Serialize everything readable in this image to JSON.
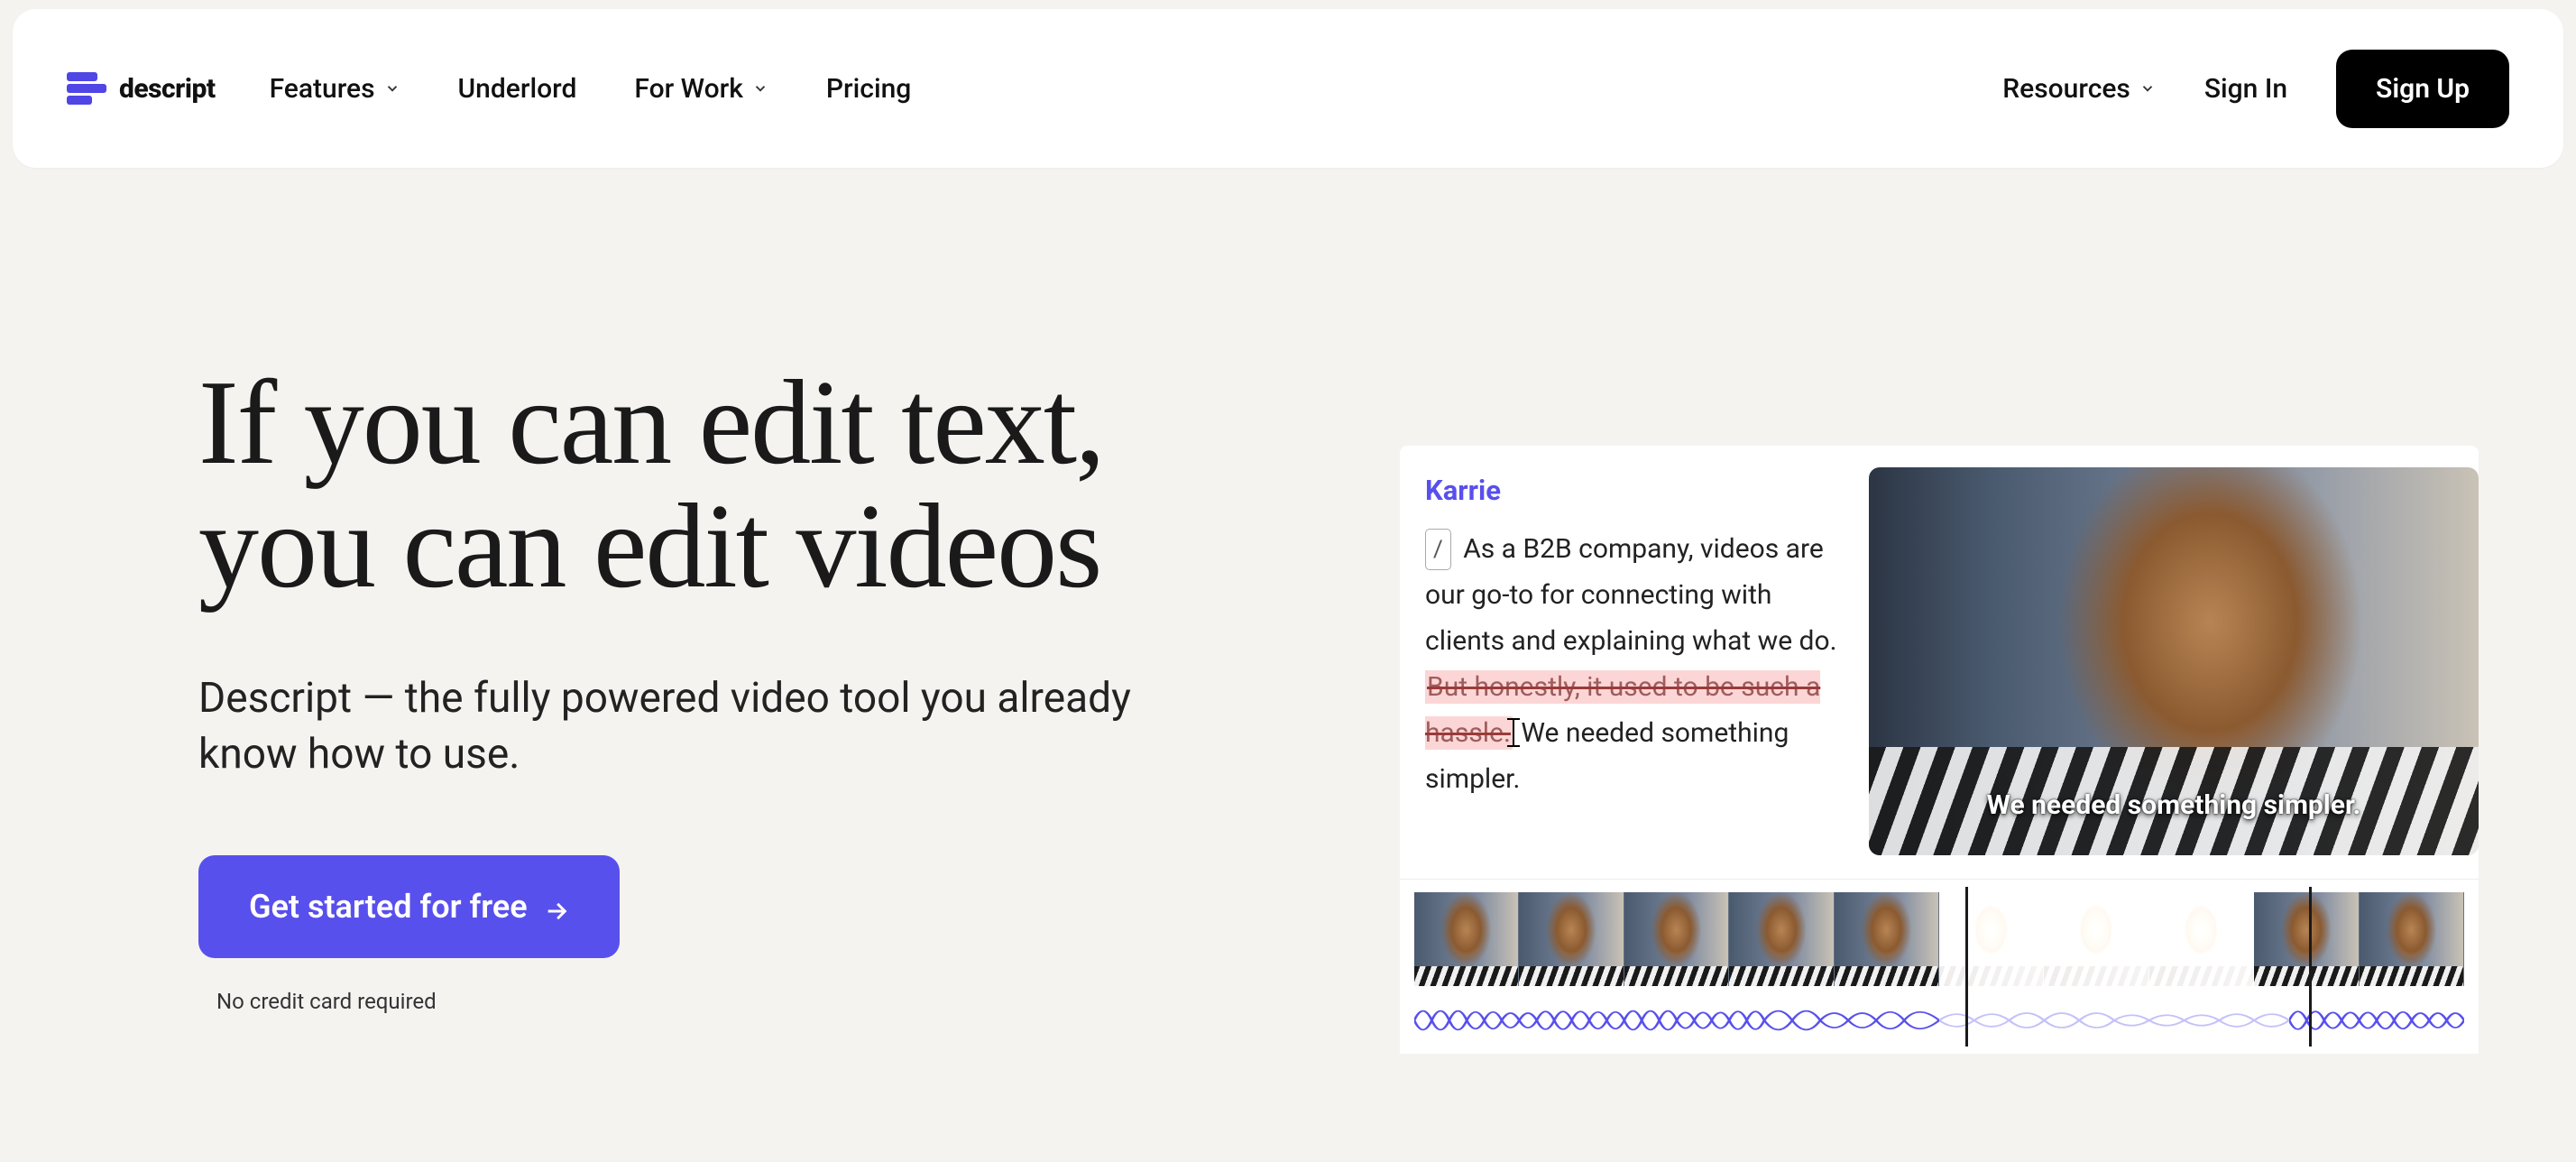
{
  "brand": {
    "name": "descript"
  },
  "nav": {
    "items": [
      {
        "label": "Features",
        "hasDropdown": true
      },
      {
        "label": "Underlord",
        "hasDropdown": false
      },
      {
        "label": "For Work",
        "hasDropdown": true
      },
      {
        "label": "Pricing",
        "hasDropdown": false
      }
    ],
    "resources": "Resources",
    "signin": "Sign In",
    "signup": "Sign Up"
  },
  "hero": {
    "headline_l1": "If you can edit text,",
    "headline_l2": "you can edit videos",
    "subhead": "Descript — the fully powered video tool you already know how to use.",
    "cta": "Get started for free",
    "disclaimer": "No credit card required"
  },
  "demo": {
    "speaker": "Karrie",
    "slash": "/",
    "text_before": "As a B2B company, videos are our go-to for connecting with clients and explaining what we do. ",
    "text_struck": "But honestly, it used to be such a hassle.",
    "text_after": " We needed something simpler.",
    "caption": "We needed something simpler."
  }
}
